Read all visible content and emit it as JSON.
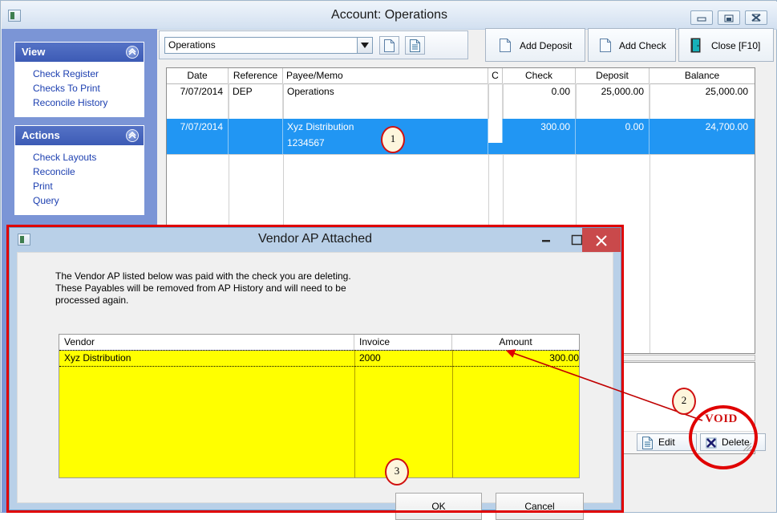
{
  "main_window": {
    "title": "Account: Operations",
    "icon": "app-icon",
    "window_buttons": {
      "minimize": "minimize-icon",
      "maximize": "maximize-icon",
      "close": "close-icon"
    }
  },
  "sidebar": {
    "panels": [
      {
        "title": "View",
        "collapse_icon": "chevron-up-icon",
        "items": [
          "Check Register",
          "Checks To Print",
          "Reconcile History"
        ]
      },
      {
        "title": "Actions",
        "collapse_icon": "chevron-up-icon",
        "items": [
          "Check Layouts",
          "Reconcile",
          "Print",
          "Query"
        ]
      }
    ]
  },
  "toolbar": {
    "account_select": {
      "value": "Operations",
      "placeholder": "Operations",
      "arrow_icon": "chevron-down-icon"
    },
    "new_button": "new-document-icon",
    "edit_button": "edit-document-icon",
    "add_deposit": {
      "label": "Add Deposit",
      "icon": "document-icon"
    },
    "add_check": {
      "label": "Add Check",
      "icon": "document-icon"
    },
    "close_f10": {
      "label": "Close [F10]",
      "icon": "exit-door-icon"
    }
  },
  "register_grid": {
    "columns": [
      "Date",
      "Reference",
      "Payee/Memo",
      "C",
      "Check",
      "Deposit",
      "Balance"
    ],
    "rows": [
      {
        "date": "7/07/2014",
        "reference": "DEP",
        "payee": "Operations",
        "memo": "",
        "c": "",
        "check": "0.00",
        "deposit": "25,000.00",
        "balance": "25,000.00",
        "selected": false
      },
      {
        "date": "7/07/2014",
        "reference": "",
        "payee": "Xyz Distribution",
        "memo": "1234567",
        "c": "",
        "check": "300.00",
        "deposit": "0.00",
        "balance": "24,700.00",
        "selected": true
      }
    ]
  },
  "bottom_panel": {
    "edit_button": {
      "label": "Edit",
      "icon": "edit-document-icon"
    },
    "delete_button": {
      "label": "Delete",
      "icon": "delete-x-icon"
    },
    "resize_grip": "resize-grip-icon"
  },
  "dialog": {
    "title": "Vendor AP Attached",
    "icon": "app-icon",
    "window_buttons": {
      "minimize": "minimize-icon",
      "maximize": "maximize-icon",
      "close": "close-icon"
    },
    "message": [
      "The Vendor AP listed below was paid with the check you are deleting.",
      "These Payables will be removed from AP History and will need to be",
      "processed again."
    ],
    "grid": {
      "columns": [
        "Vendor",
        "Invoice",
        "Amount"
      ],
      "rows": [
        {
          "vendor": "Xyz Distribution",
          "invoice": "2000",
          "amount": "300.00"
        }
      ],
      "row_highlight_color": "#ffff00"
    },
    "ok_button": "OK",
    "cancel_button": "Cancel"
  },
  "annotations": {
    "callouts": [
      {
        "number": "1",
        "target": "selected-register-row"
      },
      {
        "number": "2",
        "target": "void-delete-button"
      },
      {
        "number": "3",
        "target": "ok-button"
      }
    ],
    "void_label": "VOID",
    "highlight_color": "#e00000"
  }
}
